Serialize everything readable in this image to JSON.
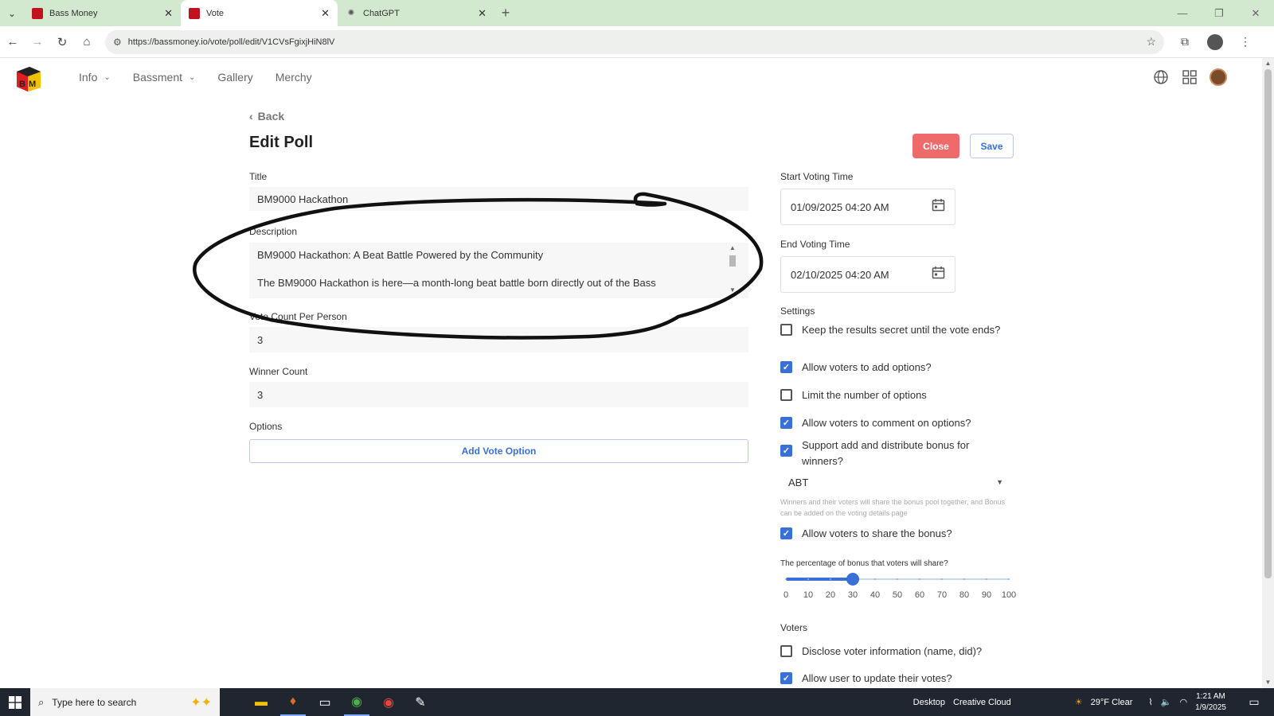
{
  "browser": {
    "tabs": [
      {
        "title": "Bass Money",
        "icon": "bass-money-favicon",
        "active": false
      },
      {
        "title": "Vote",
        "icon": "bass-money-favicon",
        "active": true
      },
      {
        "title": "ChatGPT",
        "icon": "chatgpt-favicon",
        "active": false
      }
    ],
    "url": "https://bassmoney.io/vote/poll/edit/V1CVsFgixjHiN8lV"
  },
  "header": {
    "nav": [
      {
        "label": "Info",
        "dropdown": true
      },
      {
        "label": "Bassment",
        "dropdown": true
      },
      {
        "label": "Gallery",
        "dropdown": false
      },
      {
        "label": "Merchy",
        "dropdown": false
      }
    ]
  },
  "form": {
    "back_label": "Back",
    "page_title": "Edit Poll",
    "close_label": "Close",
    "save_label": "Save",
    "title_label": "Title",
    "title_value": "BM9000  Hackathon",
    "description_label": "Description",
    "description_lines": [
      "BM9000 Hackathon: A Beat Battle Powered by the Community",
      "The BM9000 Hackathon is here—a month-long beat battle born directly out of the Bass"
    ],
    "vote_count_label": "Vote Count Per Person",
    "vote_count_value": "3",
    "winner_count_label": "Winner Count",
    "winner_count_value": "3",
    "options_label": "Options",
    "add_option_label": "Add Vote Option"
  },
  "voting": {
    "start_label": "Start Voting Time",
    "start_value": "01/09/2025 04:20 AM",
    "end_label": "End Voting Time",
    "end_value": "02/10/2025 04:20 AM"
  },
  "settings": {
    "label": "Settings",
    "items": [
      {
        "label": "Keep the results secret until the vote ends?",
        "checked": false
      },
      {
        "label": "Allow voters to add options?",
        "checked": true
      },
      {
        "label": "Limit the number of options",
        "checked": false
      },
      {
        "label": "Allow voters to comment on options?",
        "checked": true
      },
      {
        "label": "Support add and distribute bonus for winners?",
        "checked": true
      }
    ],
    "token": "ABT",
    "helper_text": "Winners and their voters will share the bonus pool together, and Bonus can be added on the voting details page",
    "share_bonus": {
      "label": "Allow voters to share the bonus?",
      "checked": true
    },
    "slider_label": "The percentage of bonus that voters will share?",
    "slider_value": 30,
    "slider_ticks": [
      "0",
      "10",
      "20",
      "30",
      "40",
      "50",
      "60",
      "70",
      "80",
      "90",
      "100"
    ]
  },
  "voters": {
    "label": "Voters",
    "items": [
      {
        "label": "Disclose voter information (name, did)?",
        "checked": false
      },
      {
        "label": "Allow user to update their votes?",
        "checked": true
      }
    ]
  },
  "taskbar": {
    "search_placeholder": "Type here to search",
    "desktop_label": "Desktop",
    "creative_cloud": "Creative Cloud",
    "weather": "29°F  Clear",
    "time": "1:21 AM",
    "date": "1/9/2025"
  },
  "colors": {
    "accent": "#3a6fd8",
    "danger": "#ef6a6a",
    "tabbar": "#d3e9cf",
    "taskbar": "#1f2630"
  }
}
